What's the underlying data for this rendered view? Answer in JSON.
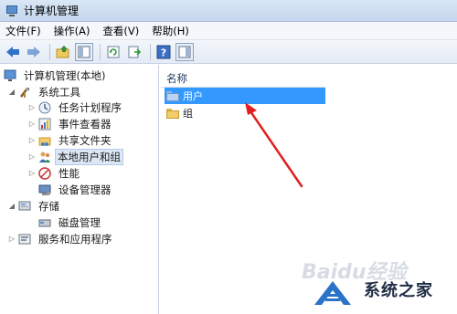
{
  "window": {
    "title": "计算机管理"
  },
  "menu": [
    "文件(F)",
    "操作(A)",
    "查看(V)",
    "帮助(H)"
  ],
  "toolbar": {
    "icons": [
      "back-arrow-icon",
      "forward-arrow-icon",
      "up-folder-icon",
      "show-hide-tree-icon",
      "refresh-icon",
      "export-icon",
      "help-icon",
      "show-hide-action-pane-icon"
    ]
  },
  "tree": {
    "root": "计算机管理(本地)",
    "system_tools": "系统工具",
    "task_scheduler": "任务计划程序",
    "event_viewer": "事件查看器",
    "shared_folders": "共享文件夹",
    "local_users_groups": "本地用户和组",
    "performance": "性能",
    "device_manager": "设备管理器",
    "storage": "存储",
    "disk_management": "磁盘管理",
    "services_apps": "服务和应用程序"
  },
  "list": {
    "column_name": "名称",
    "items": [
      "用户",
      "组"
    ],
    "selected_index": 0
  },
  "annotation": {
    "arrow_color": "#e02020"
  },
  "watermark": {
    "site_text": "系统之家",
    "faint_text": "Baidu经验"
  }
}
